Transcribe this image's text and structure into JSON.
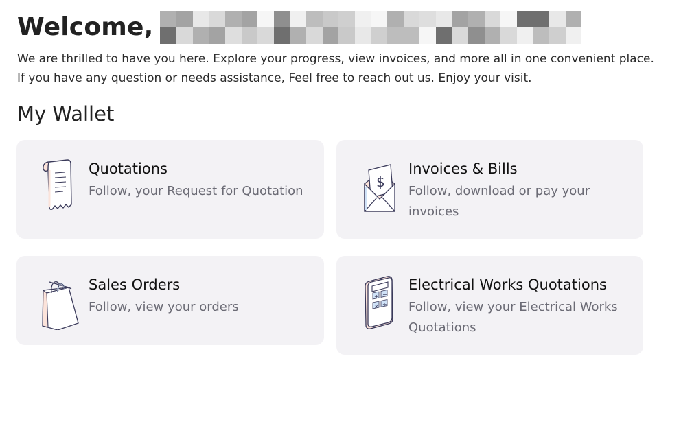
{
  "header": {
    "welcome": "Welcome,",
    "intro": "We are thrilled to have you here. Explore your progress, view invoices, and more all in one convenient place. If you have any question or needs assistance, Feel free to reach out us. Enjoy your visit."
  },
  "wallet": {
    "title": "My Wallet",
    "cards": [
      {
        "title": "Quotations",
        "description": "Follow, your Request for Quotation",
        "icon": "receipt-icon"
      },
      {
        "title": "Invoices & Bills",
        "description": "Follow, download or pay your invoices",
        "icon": "envelope-dollar-icon"
      },
      {
        "title": "Sales Orders",
        "description": "Follow, view your orders",
        "icon": "shopping-bag-icon"
      },
      {
        "title": "Electrical Works Quotations",
        "description": "Follow, view your Electrical Works Quotations",
        "icon": "calculator-icon"
      }
    ]
  },
  "colors": {
    "card_background": "#f3f2f5",
    "icon_stroke": "#3a3a5a",
    "icon_peach": "#fbe3da",
    "icon_blue": "#cfe2f7"
  }
}
